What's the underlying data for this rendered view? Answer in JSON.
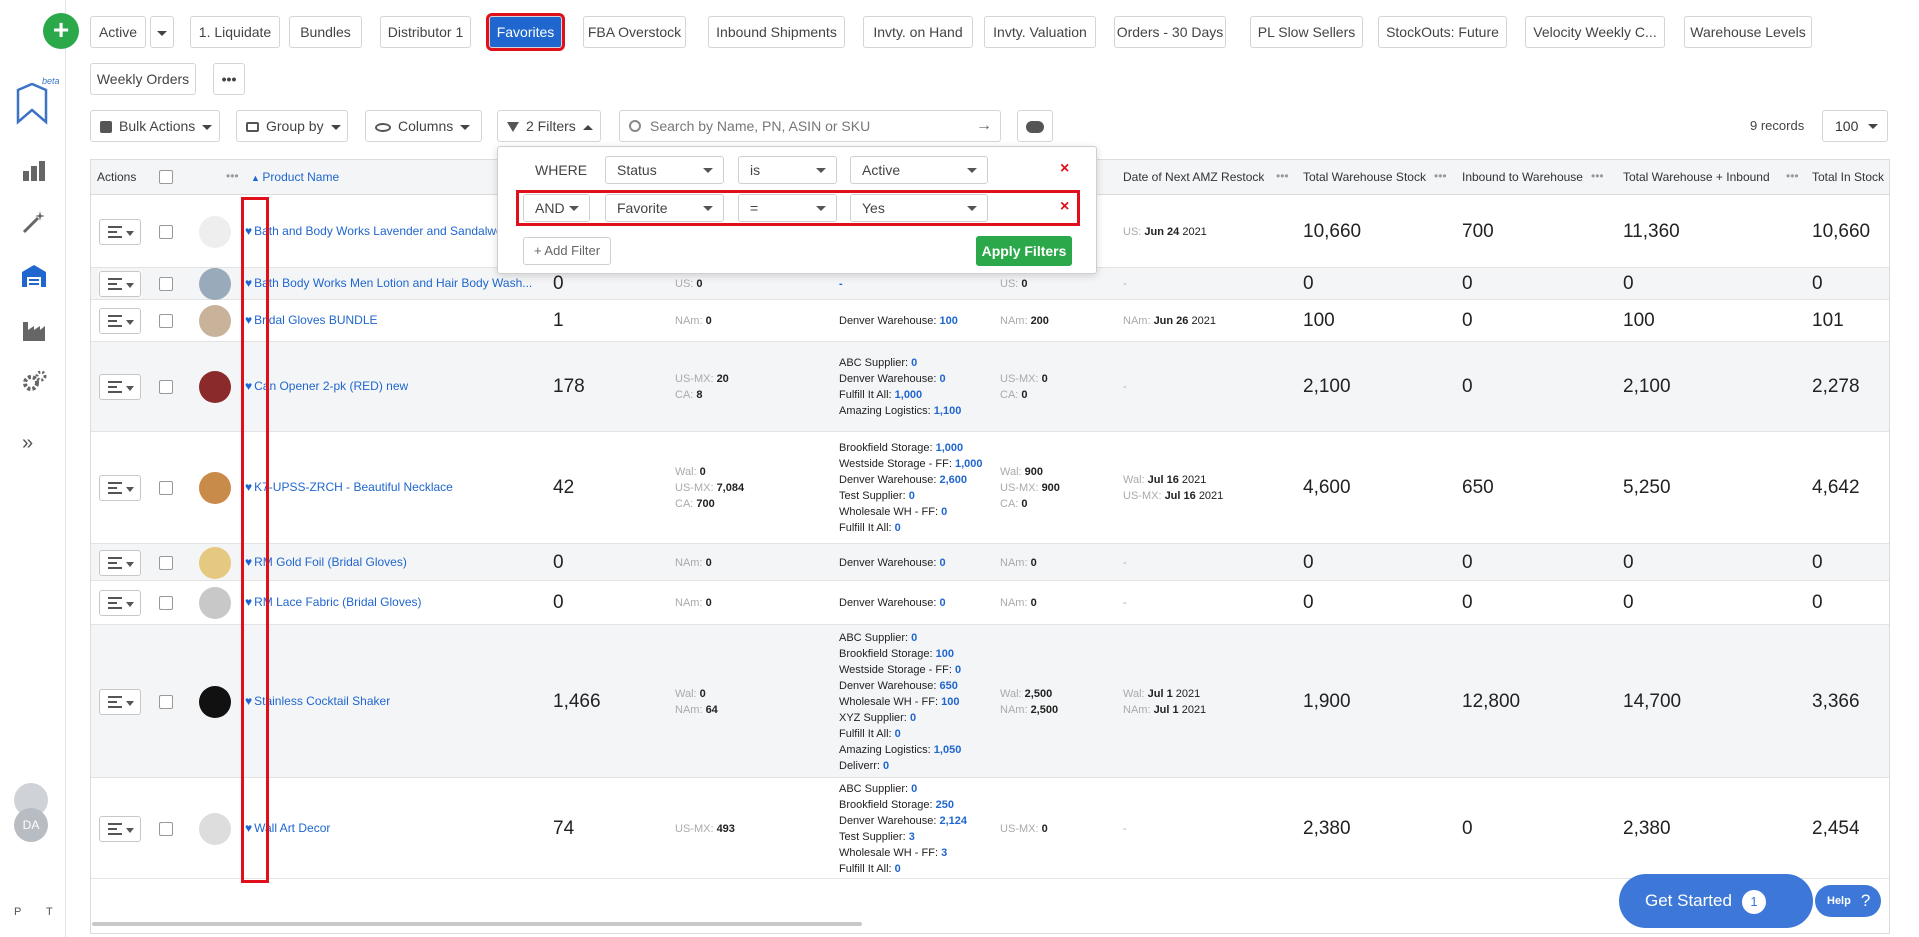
{
  "sidebar": {
    "beta": "beta",
    "avatar_initials": "DA",
    "footer_p": "P",
    "footer_t": "T",
    "items": [
      {
        "icon": "dashboard-icon"
      },
      {
        "icon": "magic-wand-icon"
      },
      {
        "icon": "warehouse-icon"
      },
      {
        "icon": "factory-icon"
      },
      {
        "icon": "settings-gear-icon"
      }
    ]
  },
  "tabs": [
    "Active",
    "1. Liquidate",
    "Bundles",
    "Distributor 1",
    "Favorites",
    "FBA Overstock",
    "Inbound Shipments",
    "Invty. on Hand",
    "Invty. Valuation",
    "Orders - 30 Days",
    "PL Slow Sellers",
    "StockOuts: Future",
    "Velocity Weekly C...",
    "Warehouse Levels",
    "Weekly Orders"
  ],
  "active_tab": "Favorites",
  "toolbar": {
    "bulk_actions": "Bulk Actions",
    "group_by": "Group by",
    "columns": "Columns",
    "filters": "2 Filters",
    "search_placeholder": "Search by Name, PN, ASIN or SKU",
    "records": "9 records",
    "per_page": "100"
  },
  "filter_panel": {
    "where": "WHERE",
    "row1": {
      "field": "Status",
      "op": "is",
      "value": "Active"
    },
    "row2": {
      "conj": "AND",
      "field": "Favorite",
      "op": "=",
      "value": "Yes"
    },
    "add_filter": "+ Add Filter",
    "apply": "Apply Filters"
  },
  "columns": {
    "actions": "Actions",
    "product_name": "Product Name",
    "next_restock": "Date of Next AMZ Restock",
    "total_wh": "Total Warehouse Stock",
    "inbound_wh": "Inbound to Warehouse",
    "total_wh_inbound": "Total Warehouse + Inbound",
    "total_in_stock": "Total In Stock"
  },
  "rows": [
    {
      "name": "Bath and Body Works Lavender and Sandalwood",
      "stock": "",
      "c3": [],
      "c4": [],
      "c5": [],
      "c6": [
        {
          "k": "US:",
          "v": "Jun 24",
          "y": "2021"
        }
      ],
      "wh": "10,660",
      "inb": "700",
      "whinb": "11,360",
      "total": "10,660"
    },
    {
      "name": "Bath Body Works Men Lotion and Hair Body Wash...",
      "stock": "0",
      "c3": [
        {
          "k": "US:",
          "v": "0"
        }
      ],
      "c4": [
        {
          "k": "",
          "v": "-"
        }
      ],
      "c5": [
        {
          "k": "US:",
          "v": "0"
        }
      ],
      "c6": [
        {
          "k": "",
          "v": "-"
        }
      ],
      "wh": "0",
      "inb": "0",
      "whinb": "0",
      "total": "0"
    },
    {
      "name": "Bridal Gloves BUNDLE",
      "stock": "1",
      "c3": [
        {
          "k": "NAm:",
          "v": "0"
        }
      ],
      "c4": [
        {
          "k": "Denver Warehouse:",
          "v": "100"
        }
      ],
      "c5": [
        {
          "k": "NAm:",
          "v": "200"
        }
      ],
      "c6": [
        {
          "k": "NAm:",
          "v": "Jun 26",
          "y": "2021"
        }
      ],
      "wh": "100",
      "inb": "0",
      "whinb": "100",
      "total": "101"
    },
    {
      "name": "Can Opener 2-pk (RED) new",
      "stock": "178",
      "c3": [
        {
          "k": "US-MX:",
          "v": "20"
        },
        {
          "k": "CA:",
          "v": "8"
        }
      ],
      "c4": [
        {
          "k": "ABC Supplier:",
          "v": "0"
        },
        {
          "k": "Denver Warehouse:",
          "v": "0"
        },
        {
          "k": "Fulfill It All:",
          "v": "1,000"
        },
        {
          "k": "Amazing Logistics:",
          "v": "1,100"
        }
      ],
      "c5": [
        {
          "k": "US-MX:",
          "v": "0"
        },
        {
          "k": "CA:",
          "v": "0"
        }
      ],
      "c6": [
        {
          "k": "",
          "v": "-"
        }
      ],
      "wh": "2,100",
      "inb": "0",
      "whinb": "2,100",
      "total": "2,278"
    },
    {
      "name": "K7-UPSS-ZRCH - Beautiful Necklace",
      "stock": "42",
      "c3": [
        {
          "k": "Wal:",
          "v": "0"
        },
        {
          "k": "US-MX:",
          "v": "7,084"
        },
        {
          "k": "CA:",
          "v": "700"
        }
      ],
      "c4": [
        {
          "k": "Brookfield Storage:",
          "v": "1,000"
        },
        {
          "k": "Westside Storage - FF:",
          "v": "1,000"
        },
        {
          "k": "Denver Warehouse:",
          "v": "2,600"
        },
        {
          "k": "Test Supplier:",
          "v": "0"
        },
        {
          "k": "Wholesale WH - FF:",
          "v": "0"
        },
        {
          "k": "Fulfill It All:",
          "v": "0"
        }
      ],
      "c5": [
        {
          "k": "Wal:",
          "v": "900"
        },
        {
          "k": "US-MX:",
          "v": "900"
        },
        {
          "k": "CA:",
          "v": "0"
        }
      ],
      "c6": [
        {
          "k": "Wal:",
          "v": "Jul 16",
          "y": "2021"
        },
        {
          "k": "US-MX:",
          "v": "Jul 16",
          "y": "2021"
        }
      ],
      "wh": "4,600",
      "inb": "650",
      "whinb": "5,250",
      "total": "4,642"
    },
    {
      "name": "RM Gold Foil (Bridal Gloves)",
      "stock": "0",
      "c3": [
        {
          "k": "NAm:",
          "v": "0"
        }
      ],
      "c4": [
        {
          "k": "Denver Warehouse:",
          "v": "0"
        }
      ],
      "c5": [
        {
          "k": "NAm:",
          "v": "0"
        }
      ],
      "c6": [
        {
          "k": "",
          "v": "-"
        }
      ],
      "wh": "0",
      "inb": "0",
      "whinb": "0",
      "total": "0"
    },
    {
      "name": "RM Lace Fabric (Bridal Gloves)",
      "stock": "0",
      "c3": [
        {
          "k": "NAm:",
          "v": "0"
        }
      ],
      "c4": [
        {
          "k": "Denver Warehouse:",
          "v": "0"
        }
      ],
      "c5": [
        {
          "k": "NAm:",
          "v": "0"
        }
      ],
      "c6": [
        {
          "k": "",
          "v": "-"
        }
      ],
      "wh": "0",
      "inb": "0",
      "whinb": "0",
      "total": "0"
    },
    {
      "name": "Stainless Cocktail Shaker",
      "stock": "1,466",
      "c3": [
        {
          "k": "Wal:",
          "v": "0"
        },
        {
          "k": "NAm:",
          "v": "64"
        }
      ],
      "c4": [
        {
          "k": "ABC Supplier:",
          "v": "0"
        },
        {
          "k": "Brookfield Storage:",
          "v": "100"
        },
        {
          "k": "Westside Storage - FF:",
          "v": "0"
        },
        {
          "k": "Denver Warehouse:",
          "v": "650"
        },
        {
          "k": "Wholesale WH - FF:",
          "v": "100"
        },
        {
          "k": "XYZ Supplier:",
          "v": "0"
        },
        {
          "k": "Fulfill It All:",
          "v": "0"
        },
        {
          "k": "Amazing Logistics:",
          "v": "1,050"
        },
        {
          "k": "Deliverr:",
          "v": "0"
        }
      ],
      "c5": [
        {
          "k": "Wal:",
          "v": "2,500"
        },
        {
          "k": "NAm:",
          "v": "2,500"
        }
      ],
      "c6": [
        {
          "k": "Wal:",
          "v": "Jul 1",
          "y": "2021"
        },
        {
          "k": "NAm:",
          "v": "Jul 1",
          "y": "2021"
        }
      ],
      "wh": "1,900",
      "inb": "12,800",
      "whinb": "14,700",
      "total": "3,366"
    },
    {
      "name": "Wall Art Decor",
      "stock": "74",
      "c3": [
        {
          "k": "US-MX:",
          "v": "493"
        }
      ],
      "c4": [
        {
          "k": "ABC Supplier:",
          "v": "0"
        },
        {
          "k": "Brookfield Storage:",
          "v": "250"
        },
        {
          "k": "Denver Warehouse:",
          "v": "2,124"
        },
        {
          "k": "Test Supplier:",
          "v": "3"
        },
        {
          "k": "Wholesale WH - FF:",
          "v": "3"
        },
        {
          "k": "Fulfill It All:",
          "v": "0"
        }
      ],
      "c5": [
        {
          "k": "US-MX:",
          "v": "0"
        }
      ],
      "c6": [
        {
          "k": "",
          "v": "-"
        }
      ],
      "wh": "2,380",
      "inb": "0",
      "whinb": "2,380",
      "total": "2,454"
    }
  ],
  "get_started": {
    "label": "Get Started",
    "count": "1"
  },
  "help": {
    "label": "Help",
    "icon": "?"
  }
}
